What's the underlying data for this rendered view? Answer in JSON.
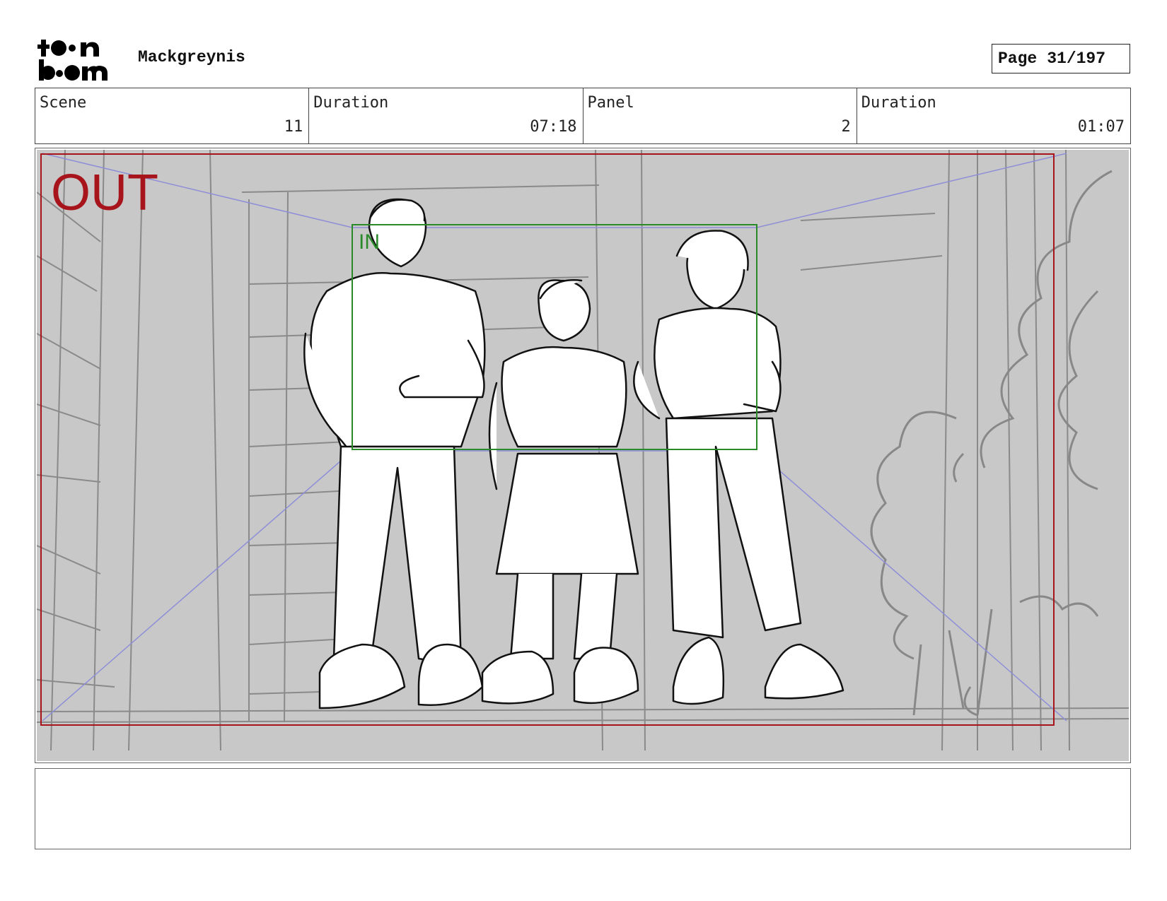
{
  "header": {
    "logo_text": "toonboom",
    "project_name": "Mackgreynis",
    "page_label": "Page",
    "page_value": "31/197"
  },
  "info": {
    "scene_label": "Scene",
    "scene_value": "11",
    "scene_duration_label": "Duration",
    "scene_duration_value": "07:18",
    "panel_label": "Panel",
    "panel_value": "2",
    "panel_duration_label": "Duration",
    "panel_duration_value": "01:07"
  },
  "frame": {
    "out_label": "OUT",
    "in_label": "IN",
    "out_color": "#a8141c",
    "in_color": "#2a8a2a",
    "background": "#c8c8c8"
  },
  "notes": {
    "text": ""
  }
}
